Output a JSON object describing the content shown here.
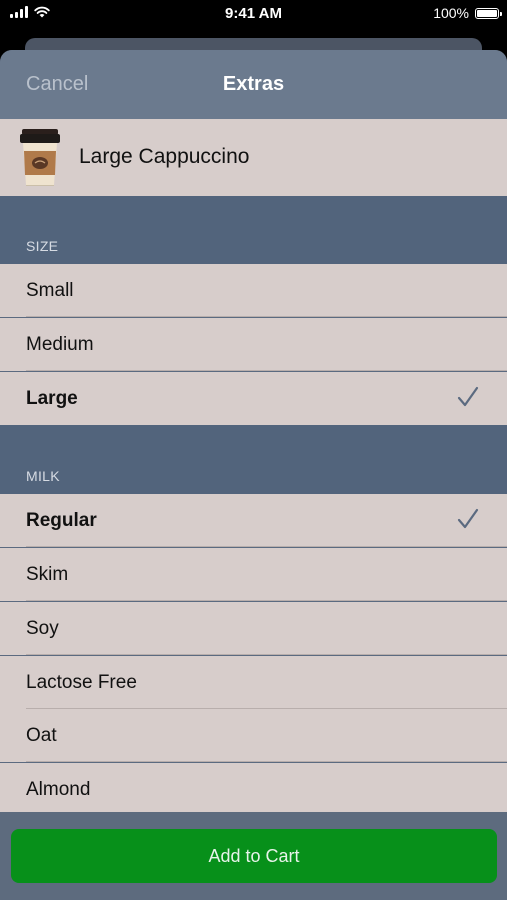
{
  "status_bar": {
    "time": "9:41 AM",
    "battery_text": "100%"
  },
  "nav": {
    "cancel_label": "Cancel",
    "title": "Extras"
  },
  "product": {
    "name": "Large Cappuccino",
    "icon": "coffee-cup-icon"
  },
  "sections": {
    "size": {
      "header": "SIZE",
      "options": [
        {
          "label": "Small",
          "selected": false
        },
        {
          "label": "Medium",
          "selected": false
        },
        {
          "label": "Large",
          "selected": true
        }
      ]
    },
    "milk": {
      "header": "MILK",
      "options": [
        {
          "label": "Regular",
          "selected": true
        },
        {
          "label": "Skim",
          "selected": false
        },
        {
          "label": "Soy",
          "selected": false
        },
        {
          "label": "Lactose Free",
          "selected": false
        },
        {
          "label": "Oat",
          "selected": false
        },
        {
          "label": "Almond",
          "selected": false
        }
      ]
    }
  },
  "footer": {
    "add_to_cart_label": "Add to Cart"
  },
  "colors": {
    "accent_green": "#07901a",
    "checkmark": "#5b6a80",
    "row_bg": "#d7cdcb",
    "section_bg": "#52647c"
  }
}
